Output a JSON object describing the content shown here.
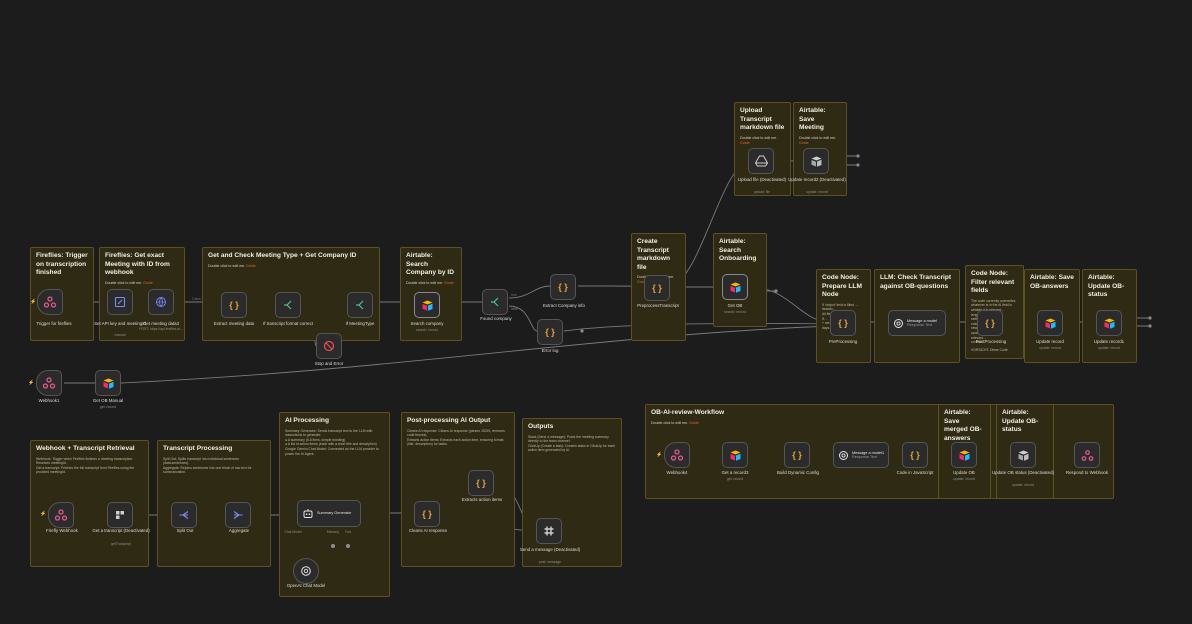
{
  "stickies": {
    "fireflies_trigger": {
      "title": "Fireflies: Trigger on transcription finished"
    },
    "fireflies_get": {
      "title": "Fireflies: Get exact Meeting with ID from webhook",
      "hint": "Double click to edit me.",
      "guide": "Guide"
    },
    "meeting_type": {
      "title": "Get and Check Meeting Type + Get Company ID",
      "hint": "Double click to edit me.",
      "guide": "Guide"
    },
    "airtable_search": {
      "title": "Airtable: Search Company by ID",
      "hint": "Double click to edit me.",
      "guide": "Guide"
    },
    "create_transcript": {
      "title": "Create Transcript markdown file",
      "hint": "Double click to edit me.",
      "guide": "Guide"
    },
    "upload_transcript": {
      "title": "Upload Transcript markdown file",
      "hint": "Double click to edit me.",
      "guide": "Guide"
    },
    "airtable_save": {
      "title": "Airtable: Save Meeting",
      "hint": "Double click to edit me.",
      "guide": "Guide"
    },
    "airtable_onboarding": {
      "title": "Airtable: Search Onboarding"
    },
    "code_llm": {
      "title": "Code Node: Prepare LLM Node",
      "body": "If 'output' field is filled → deactiv... \nAll fields... \nIf... \n+ set... \ndays..."
    },
    "llm_check": {
      "title": "LLM: Check Transcript against OB-questions"
    },
    "code_filter": {
      "title": "Code Node: Filter relevant fields",
      "body": "The code currently overwrites whatever is in the AI field in airtable it is relevant... \nlength... \nselect... \ncolumn... \nnew... \nupdate... \nrelevant... \ncontent",
      "footer": "VORSICHT: Diese Code"
    },
    "airtable_ob": {
      "title": "Airtable: Save OB-answers"
    },
    "airtable_update_status": {
      "title": "Airtable: Update OB-status"
    },
    "webhook_retrieval": {
      "title": "Webhook + Transcript Retrieval",
      "body": "Webhook: Trigger when Fireflies finishes a meeting transcription. Receives meetingId.\nGet a transcript: Fetches the full transcript from Fireflies using the provided meetingId."
    },
    "transcript_processing": {
      "title": "Transcript Processing",
      "body": "Split Out: Splits transcript into individual sentences (data.sentences).\nAggregate: Rejoins sentences into one block of raw text for summarization."
    },
    "ai_processing": {
      "title": "AI Processing",
      "body": "Summary Generator: Sends transcript text to the LLM with instructions to generate:\n● A summary (5-6 lines, simple wording)\n● A list of action items (each with a short title and description)\nGoogle Gemini Chat Model: Connected as the LLM provider to power the AI Agent."
    },
    "post_processing": {
      "title": "Post-processing AI Output",
      "body": "Cleans AI response: Cleans AI response (parses JSON, removes code fences).\nExtracts action items: Extracts each action item, ensuring format (title, description) for tasks."
    },
    "outputs": {
      "title": "Outputs",
      "body": "Slack (Send a message): Posts the meeting summary directly to the team channel.\nClickUp (Create a task): Creates tasks in ClickUp for each action item generated by AI."
    },
    "ob_review": {
      "title": "OB-AI-review-Workflow",
      "hint": "Double click to edit me.",
      "guide": "Guide"
    },
    "airtable_merged": {
      "title": "Airtable: Save merged OB-answers"
    },
    "airtable_update_ob": {
      "title": "Airtable: Update OB-status"
    }
  },
  "nodes": {
    "trigger_fireflies": {
      "label": "Trigger for fireflies",
      "icon": "webhook-icon"
    },
    "set_api_key": {
      "label": "Set API key and meetingId",
      "sub": "manual",
      "icon": "edit-icon"
    },
    "get_meeting_data": {
      "label": "Get meeting data3",
      "sub": "POST: https://api.fireflies.ai...",
      "icon": "globe-icon"
    },
    "extract_meeting": {
      "label": "Extract meeting data",
      "icon": "code-icon"
    },
    "if_transcript": {
      "label": "If transcript format correct",
      "icon": "if-icon"
    },
    "if_meeting_type": {
      "label": "If MeetingType",
      "icon": "if-icon"
    },
    "stop_error": {
      "label": "Stop and Error",
      "icon": "stop-icon"
    },
    "search_company": {
      "label": "Search company",
      "sub": "search: record",
      "icon": "airtable-icon"
    },
    "found_company": {
      "label": "Found company",
      "icon": "if-icon"
    },
    "extract_company": {
      "label": "Extract Company info",
      "icon": "code-icon"
    },
    "error_log": {
      "label": "Error log",
      "icon": "code-icon"
    },
    "preprocess_transcript": {
      "label": "PreprocessTranscript",
      "icon": "code-icon"
    },
    "upload_file": {
      "label": "Upload file (Deactivated)",
      "sub": "upload: file",
      "icon": "drive-icon"
    },
    "update_record2": {
      "label": "Update record2 (Deactivated)",
      "sub": "update: record",
      "icon": "airtable-icon"
    },
    "get_ob": {
      "label": "Get OB",
      "sub": "search: record",
      "icon": "airtable-icon"
    },
    "preprocessing": {
      "label": "PreProcessing",
      "icon": "code-icon"
    },
    "message_model": {
      "title": "Message a model",
      "sub": "Response Text",
      "icon": "openai-icon"
    },
    "postprocessing": {
      "label": "PostProcessing",
      "icon": "code-icon"
    },
    "update_record": {
      "label": "Update record",
      "sub": "update: record",
      "icon": "airtable-icon"
    },
    "update_record1": {
      "label": "Update record1",
      "sub": "update: record",
      "icon": "airtable-icon"
    },
    "webhook1": {
      "label": "Webhook1",
      "icon": "webhook-icon"
    },
    "get_ob_manual": {
      "label": "Get OB Manual",
      "sub": "get: record",
      "icon": "airtable-icon"
    },
    "firefly_webhook": {
      "label": "Firefly Webhook",
      "icon": "webhook-icon"
    },
    "get_transcript": {
      "label": "Get a transcript (Deactivated)",
      "sub": "getTranscript",
      "icon": "fireflies-icon"
    },
    "split_out": {
      "label": "Split Out",
      "icon": "split-icon"
    },
    "aggregate": {
      "label": "Aggregate",
      "icon": "aggregate-icon"
    },
    "summary_generator": {
      "title": "Summary Generator",
      "icon": "agent-icon"
    },
    "chat_model": {
      "label": "OpenAI Chat Model",
      "icon": "openai-icon"
    },
    "cleans_ai": {
      "label": "Cleans AI response",
      "icon": "code-icon"
    },
    "extracts_action": {
      "label": "Extracts action items",
      "icon": "code-icon"
    },
    "send_message": {
      "label": "Send a message (Deactivated)",
      "sub": "post: message",
      "icon": "slack-icon"
    },
    "webhook4": {
      "label": "Webhook4",
      "icon": "webhook-icon"
    },
    "get_record3": {
      "label": "Get a record3",
      "sub": "get: record",
      "icon": "airtable-icon"
    },
    "build_config": {
      "label": "Build Dynamic Config",
      "icon": "code-icon"
    },
    "message_model2": {
      "title": "Message a model1",
      "sub": "Response Text",
      "icon": "openai-icon"
    },
    "code_js": {
      "label": "Code in JavaScript",
      "icon": "code-icon"
    },
    "update_ob": {
      "label": "Update OB",
      "sub": "update: record",
      "icon": "airtable-icon"
    },
    "update_ob_status": {
      "label": "Update OB status (Deactivated)",
      "sub": "update: record",
      "icon": "airtable-icon"
    },
    "respond_webhook": {
      "label": "Respond to Webhook",
      "icon": "respond-icon"
    }
  },
  "edge_labels": {
    "items": "1 item",
    "true": "true",
    "false": "false"
  },
  "summary_ports": {
    "chat": "Chat Model",
    "memory": "Memory",
    "tool": "Tool"
  },
  "colors": {
    "canvas": "#1c1c1c",
    "sticky": "#2f2a13",
    "sticky_border": "#5e5120",
    "node": "#2b2b2b",
    "wire": "#7d7d7d",
    "accent": "#ff6d5a"
  }
}
